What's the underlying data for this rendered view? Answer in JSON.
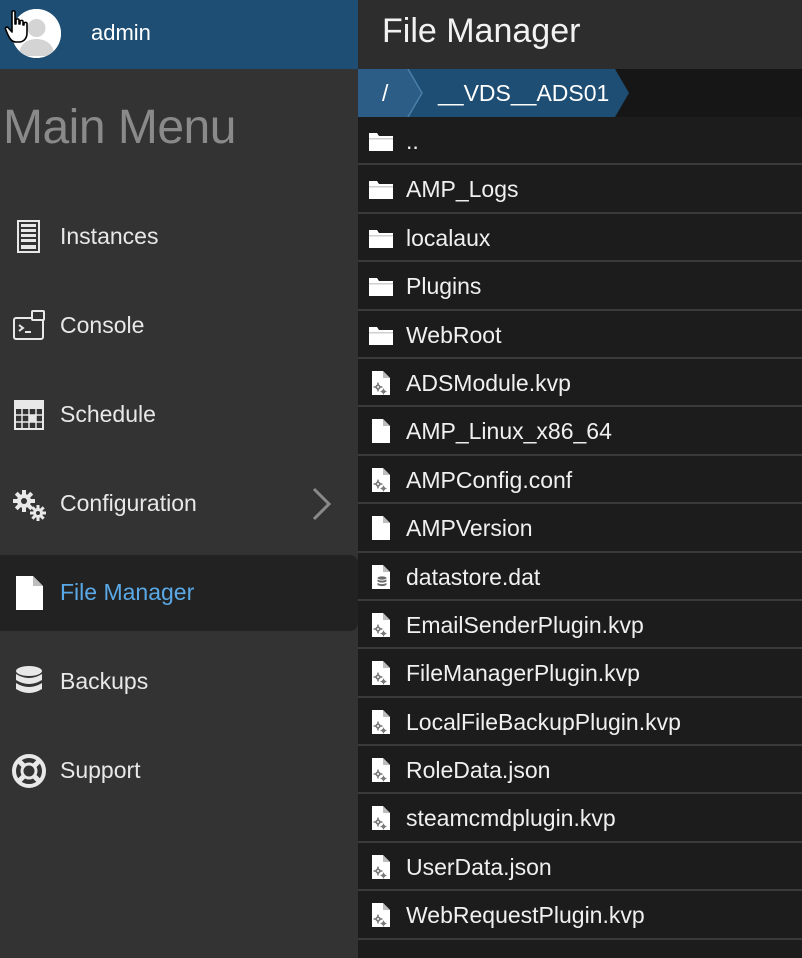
{
  "user": {
    "name": "admin"
  },
  "sidebar": {
    "title": "Main Menu",
    "items": [
      {
        "label": "Instances",
        "icon": "instances-icon"
      },
      {
        "label": "Console",
        "icon": "console-icon"
      },
      {
        "label": "Schedule",
        "icon": "schedule-icon"
      },
      {
        "label": "Configuration",
        "icon": "gears-icon",
        "has_submenu": true
      },
      {
        "label": "File Manager",
        "icon": "file-icon",
        "active": true
      },
      {
        "label": "Backups",
        "icon": "database-icon"
      },
      {
        "label": "Support",
        "icon": "lifebuoy-icon"
      }
    ]
  },
  "header": {
    "title": "File Manager"
  },
  "breadcrumb": {
    "root": "/",
    "current": "__VDS__ADS01"
  },
  "files": [
    {
      "name": "..",
      "type": "folder"
    },
    {
      "name": "AMP_Logs",
      "type": "folder"
    },
    {
      "name": "localaux",
      "type": "folder"
    },
    {
      "name": "Plugins",
      "type": "folder"
    },
    {
      "name": "WebRoot",
      "type": "folder"
    },
    {
      "name": "ADSModule.kvp",
      "type": "config"
    },
    {
      "name": "AMP_Linux_x86_64",
      "type": "file"
    },
    {
      "name": "AMPConfig.conf",
      "type": "config"
    },
    {
      "name": "AMPVersion",
      "type": "file"
    },
    {
      "name": "datastore.dat",
      "type": "data"
    },
    {
      "name": "EmailSenderPlugin.kvp",
      "type": "config"
    },
    {
      "name": "FileManagerPlugin.kvp",
      "type": "config"
    },
    {
      "name": "LocalFileBackupPlugin.kvp",
      "type": "config"
    },
    {
      "name": "RoleData.json",
      "type": "config"
    },
    {
      "name": "steamcmdplugin.kvp",
      "type": "config"
    },
    {
      "name": "UserData.json",
      "type": "config"
    },
    {
      "name": "WebRequestPlugin.kvp",
      "type": "config"
    }
  ],
  "colors": {
    "user_bar": "#1e4e73",
    "sidebar_bg": "#333333",
    "active_label": "#5aa9e6",
    "breadcrumb_root": "#2c5d87",
    "breadcrumb_current": "#1e4e73"
  }
}
